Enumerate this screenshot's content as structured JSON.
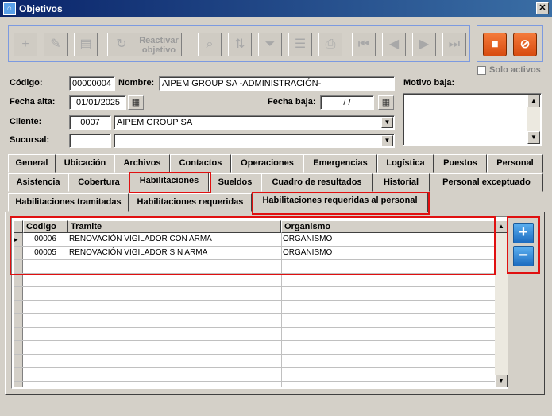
{
  "window": {
    "title": "Objetivos",
    "close_glyph": "✕"
  },
  "toolbar": {
    "reactivar_line1": "Reactivar",
    "reactivar_line2": "objetivo",
    "solo_activos": "Solo activos"
  },
  "form": {
    "codigo_label": "Código:",
    "codigo_value": "00000004",
    "nombre_label": "Nombre:",
    "nombre_value": "AIPEM GROUP SA -ADMINISTRACIÓN-",
    "motivo_label": "Motivo baja:",
    "fecha_alta_label": "Fecha alta:",
    "fecha_alta_value": "01/01/2025",
    "fecha_baja_label": "Fecha baja:",
    "fecha_baja_value": "/ /",
    "cliente_label": "Cliente:",
    "cliente_code": "0007",
    "cliente_name": "AIPEM GROUP SA",
    "sucursal_label": "Sucursal:",
    "sucursal_code": "",
    "sucursal_name": ""
  },
  "tabs_row1": [
    "General",
    "Ubicación",
    "Archivos",
    "Contactos",
    "Operaciones",
    "Emergencias",
    "Logística",
    "Puestos",
    "Personal"
  ],
  "tabs_row2": [
    "Asistencia",
    "Cobertura",
    "Habilitaciones",
    "Sueldos",
    "Cuadro de resultados",
    "Historial",
    "Personal exceptuado"
  ],
  "tabs_row3": [
    "Habilitaciones tramitadas",
    "Habilitaciones requeridas",
    "Habilitaciones requeridas al personal"
  ],
  "grid": {
    "headers": [
      "Codigo",
      "Tramite",
      "Organismo"
    ],
    "rows": [
      {
        "codigo": "00006",
        "tramite": "RENOVACIÓN VIGILADOR CON ARMA",
        "organismo": "ORGANISMO"
      },
      {
        "codigo": "00005",
        "tramite": "RENOVACIÓN VIGILADOR SIN ARMA",
        "organismo": "ORGANISMO"
      }
    ]
  },
  "icons": {
    "add": "+",
    "edit": "✎",
    "doc": "▤",
    "reactivar": "↻",
    "search": "⌕",
    "sort": "⇅",
    "filter": "⏷",
    "report": "☰",
    "print": "⎙",
    "first": "⏮",
    "prev": "◀",
    "next": "▶",
    "last": "⏭",
    "save": "■",
    "cancel": "⊘",
    "calendar": "▦",
    "dropdown": "▼",
    "scroll_up": "▲",
    "scroll_down": "▼",
    "row_pointer": "▸",
    "grid_add": "+",
    "grid_remove": "−"
  }
}
